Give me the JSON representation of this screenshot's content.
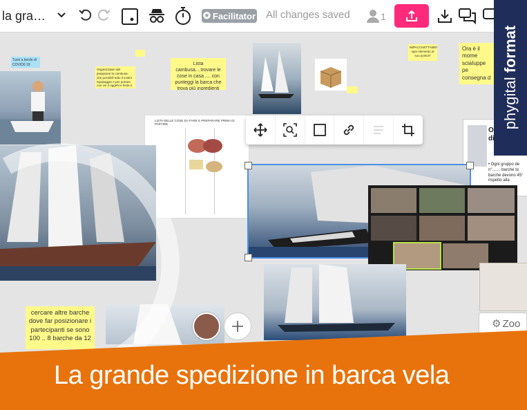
{
  "toolbar": {
    "board_title": "la gra…",
    "facilitator_label": "Facilitator",
    "save_status": "All changes saved",
    "user_count": "1"
  },
  "canvas": {
    "stickies": {
      "turni": "Turni a bordo di COVID0 19",
      "organizzatori": "Organizzatori del prepararsi la cambusa: che possibili tutto il vostro equipaggio e per portare con voi 3 oggetti e festa e cui non potete rinunciare",
      "lista_cambusa": "Lista cambusa....trovare le cose in casa .... con punteggi la barca che trova più ingredienti ....ha tot punti",
      "impacchettamento": "IMPACCHETTAMENTO ogni elemento al suo posto!!!",
      "ora": "Ora è il mome sciaIuppe pe consegna d",
      "cercare": "cercare altre barche dove far posizionare i partecipanti se sono 100 .. 8 barche da 12"
    },
    "doc_header": "LISTA DELLE COSE DA FARE E PREPARARE PRIMA DI PARTIRE",
    "right_card": {
      "title": "O\ndi",
      "body": "• Ogni gruppo de n°....... barche to barche devono 45° rispetto alla"
    },
    "zoom_label": "Zoo"
  },
  "banner": {
    "title": "La grande spedizione in barca vela",
    "brand_light": "phygital",
    "brand_bold": "format"
  },
  "colors": {
    "accent_pink": "#ff2a7a",
    "banner_orange": "#e8730c",
    "brand_navy": "#1f2d5a",
    "sticky_yellow": "#fff98a",
    "selection_blue": "#4a90e2"
  }
}
